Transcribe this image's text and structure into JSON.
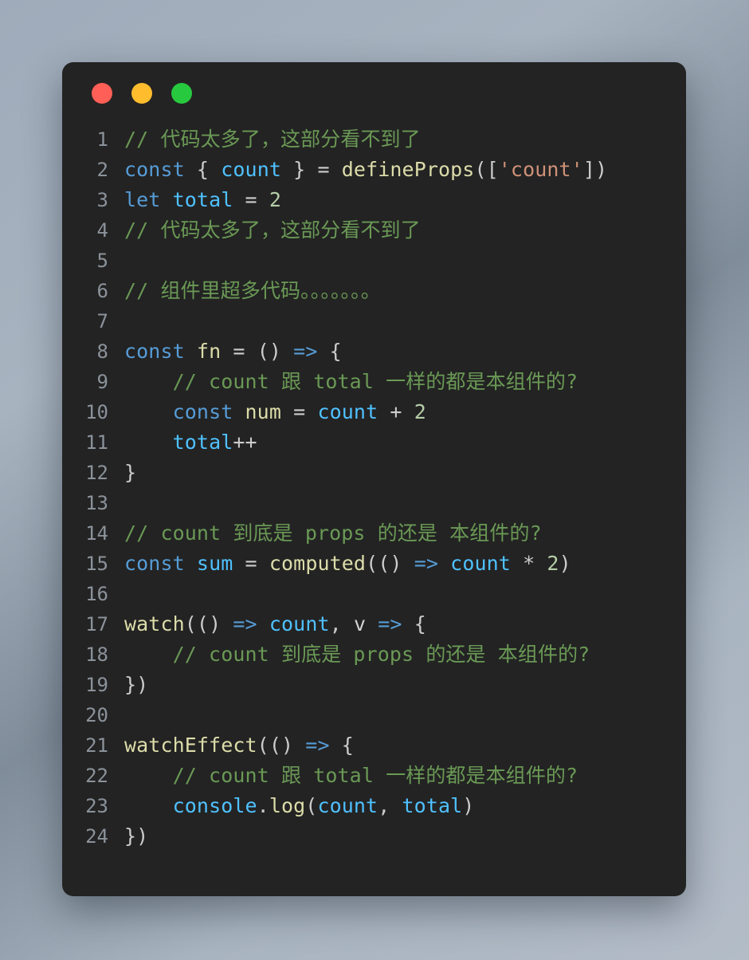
{
  "window": {
    "traffic_lights": [
      {
        "name": "close",
        "color": "#ff5f56"
      },
      {
        "name": "minimize",
        "color": "#ffbd2e"
      },
      {
        "name": "maximize",
        "color": "#27c93f"
      }
    ]
  },
  "editor": {
    "first_line_number": 1,
    "total_lines": 24,
    "background": "#232323",
    "gutter_color": "#8b929a",
    "lines": [
      {
        "number": "1",
        "tokens": [
          {
            "text": "// 代码太多了，这部分看不到了",
            "type": "comment"
          }
        ]
      },
      {
        "number": "2",
        "tokens": [
          {
            "text": "const",
            "type": "keyword"
          },
          {
            "text": " ",
            "type": "plain"
          },
          {
            "text": "{",
            "type": "punc"
          },
          {
            "text": " ",
            "type": "plain"
          },
          {
            "text": "count",
            "type": "var"
          },
          {
            "text": " ",
            "type": "plain"
          },
          {
            "text": "}",
            "type": "punc"
          },
          {
            "text": " ",
            "type": "plain"
          },
          {
            "text": "=",
            "type": "punc"
          },
          {
            "text": " ",
            "type": "plain"
          },
          {
            "text": "defineProps",
            "type": "func"
          },
          {
            "text": "([",
            "type": "punc"
          },
          {
            "text": "'count'",
            "type": "string"
          },
          {
            "text": "])",
            "type": "punc"
          }
        ]
      },
      {
        "number": "3",
        "tokens": [
          {
            "text": "let",
            "type": "keyword"
          },
          {
            "text": " ",
            "type": "plain"
          },
          {
            "text": "total",
            "type": "var"
          },
          {
            "text": " ",
            "type": "plain"
          },
          {
            "text": "=",
            "type": "punc"
          },
          {
            "text": " ",
            "type": "plain"
          },
          {
            "text": "2",
            "type": "number"
          }
        ]
      },
      {
        "number": "4",
        "tokens": [
          {
            "text": "// 代码太多了，这部分看不到了",
            "type": "comment"
          }
        ]
      },
      {
        "number": "5",
        "tokens": []
      },
      {
        "number": "6",
        "tokens": [
          {
            "text": "// 组件里超多代码。。。。。。。",
            "type": "comment"
          }
        ]
      },
      {
        "number": "7",
        "tokens": []
      },
      {
        "number": "8",
        "tokens": [
          {
            "text": "const",
            "type": "keyword"
          },
          {
            "text": " ",
            "type": "plain"
          },
          {
            "text": "fn",
            "type": "func"
          },
          {
            "text": " ",
            "type": "plain"
          },
          {
            "text": "=",
            "type": "punc"
          },
          {
            "text": " ",
            "type": "plain"
          },
          {
            "text": "()",
            "type": "punc"
          },
          {
            "text": " ",
            "type": "plain"
          },
          {
            "text": "=>",
            "type": "arrow"
          },
          {
            "text": " ",
            "type": "plain"
          },
          {
            "text": "{",
            "type": "punc"
          }
        ]
      },
      {
        "number": "9",
        "tokens": [
          {
            "text": "    // count 跟 total 一样的都是本组件的?",
            "type": "comment"
          }
        ]
      },
      {
        "number": "10",
        "tokens": [
          {
            "text": "    ",
            "type": "plain"
          },
          {
            "text": "const",
            "type": "keyword"
          },
          {
            "text": " ",
            "type": "plain"
          },
          {
            "text": "num",
            "type": "func"
          },
          {
            "text": " ",
            "type": "plain"
          },
          {
            "text": "=",
            "type": "punc"
          },
          {
            "text": " ",
            "type": "plain"
          },
          {
            "text": "count",
            "type": "var"
          },
          {
            "text": " ",
            "type": "plain"
          },
          {
            "text": "+",
            "type": "punc"
          },
          {
            "text": " ",
            "type": "plain"
          },
          {
            "text": "2",
            "type": "number"
          }
        ]
      },
      {
        "number": "11",
        "tokens": [
          {
            "text": "    ",
            "type": "plain"
          },
          {
            "text": "total",
            "type": "var"
          },
          {
            "text": "++",
            "type": "punc"
          }
        ]
      },
      {
        "number": "12",
        "tokens": [
          {
            "text": "}",
            "type": "punc"
          }
        ]
      },
      {
        "number": "13",
        "tokens": []
      },
      {
        "number": "14",
        "tokens": [
          {
            "text": "// count 到底是 props 的还是 本组件的?",
            "type": "comment"
          }
        ]
      },
      {
        "number": "15",
        "tokens": [
          {
            "text": "const",
            "type": "keyword"
          },
          {
            "text": " ",
            "type": "plain"
          },
          {
            "text": "sum",
            "type": "var"
          },
          {
            "text": " ",
            "type": "plain"
          },
          {
            "text": "=",
            "type": "punc"
          },
          {
            "text": " ",
            "type": "plain"
          },
          {
            "text": "computed",
            "type": "func"
          },
          {
            "text": "(()",
            "type": "punc"
          },
          {
            "text": " ",
            "type": "plain"
          },
          {
            "text": "=>",
            "type": "arrow"
          },
          {
            "text": " ",
            "type": "plain"
          },
          {
            "text": "count",
            "type": "var"
          },
          {
            "text": " ",
            "type": "plain"
          },
          {
            "text": "*",
            "type": "punc"
          },
          {
            "text": " ",
            "type": "plain"
          },
          {
            "text": "2",
            "type": "number"
          },
          {
            "text": ")",
            "type": "punc"
          }
        ]
      },
      {
        "number": "16",
        "tokens": []
      },
      {
        "number": "17",
        "tokens": [
          {
            "text": "watch",
            "type": "func"
          },
          {
            "text": "(()",
            "type": "punc"
          },
          {
            "text": " ",
            "type": "plain"
          },
          {
            "text": "=>",
            "type": "arrow"
          },
          {
            "text": " ",
            "type": "plain"
          },
          {
            "text": "count",
            "type": "var"
          },
          {
            "text": ",",
            "type": "punc"
          },
          {
            "text": " ",
            "type": "plain"
          },
          {
            "text": "v",
            "type": "plain"
          },
          {
            "text": " ",
            "type": "plain"
          },
          {
            "text": "=>",
            "type": "arrow"
          },
          {
            "text": " ",
            "type": "plain"
          },
          {
            "text": "{",
            "type": "punc"
          }
        ]
      },
      {
        "number": "18",
        "tokens": [
          {
            "text": "    // count 到底是 props 的还是 本组件的?",
            "type": "comment"
          }
        ]
      },
      {
        "number": "19",
        "tokens": [
          {
            "text": "})",
            "type": "punc"
          }
        ]
      },
      {
        "number": "20",
        "tokens": []
      },
      {
        "number": "21",
        "tokens": [
          {
            "text": "watchEffect",
            "type": "func"
          },
          {
            "text": "(()",
            "type": "punc"
          },
          {
            "text": " ",
            "type": "plain"
          },
          {
            "text": "=>",
            "type": "arrow"
          },
          {
            "text": " ",
            "type": "plain"
          },
          {
            "text": "{",
            "type": "punc"
          }
        ]
      },
      {
        "number": "22",
        "tokens": [
          {
            "text": "    // count 跟 total 一样的都是本组件的?",
            "type": "comment"
          }
        ]
      },
      {
        "number": "23",
        "tokens": [
          {
            "text": "    ",
            "type": "plain"
          },
          {
            "text": "console",
            "type": "var"
          },
          {
            "text": ".",
            "type": "punc"
          },
          {
            "text": "log",
            "type": "func"
          },
          {
            "text": "(",
            "type": "punc"
          },
          {
            "text": "count",
            "type": "var"
          },
          {
            "text": ",",
            "type": "punc"
          },
          {
            "text": " ",
            "type": "plain"
          },
          {
            "text": "total",
            "type": "var"
          },
          {
            "text": ")",
            "type": "punc"
          }
        ]
      },
      {
        "number": "24",
        "tokens": [
          {
            "text": "})",
            "type": "punc"
          }
        ]
      }
    ]
  }
}
